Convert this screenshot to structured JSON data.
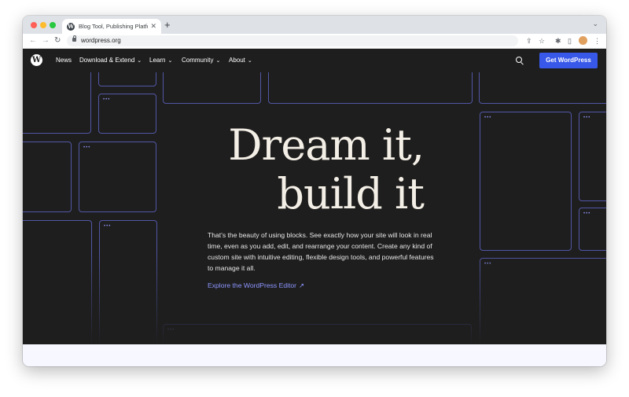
{
  "browser": {
    "tab": {
      "favicon": "W",
      "title": "Blog Tool, Publishing Platform,",
      "close": "✕"
    },
    "new_tab": "+",
    "tab_menu": "⌄",
    "nav": {
      "back": "←",
      "forward": "→",
      "reload": "↻"
    },
    "url": "wordpress.org",
    "icons": {
      "share": "⇪",
      "star": "☆",
      "extensions": "✱",
      "sidepanel": "▯",
      "menu": "⋮"
    }
  },
  "site_nav": {
    "logo": "W",
    "items": [
      {
        "label": "News",
        "chevron": ""
      },
      {
        "label": "Download & Extend",
        "chevron": "⌄"
      },
      {
        "label": "Learn",
        "chevron": "⌄"
      },
      {
        "label": "Community",
        "chevron": "⌄"
      },
      {
        "label": "About",
        "chevron": "⌄"
      }
    ],
    "cta": "Get WordPress"
  },
  "hero": {
    "headline_line1": "Dream it,",
    "headline_line2": "build it",
    "description": "That's the beauty of using blocks. See exactly how your site will look in real time, even as you add, edit, and rearrange your content. Create any kind of custom site with intuitive editing, flexible design tools, and powerful features to manage it all.",
    "link_label": "Explore the WordPress Editor",
    "link_icon": "↗",
    "block_dots": "•••"
  },
  "colors": {
    "hero_bg": "#1e1e1e",
    "accent_button": "#3858e9",
    "link": "#8d96ff",
    "block_outline": "#5257a6",
    "headline": "#f4efe6"
  }
}
